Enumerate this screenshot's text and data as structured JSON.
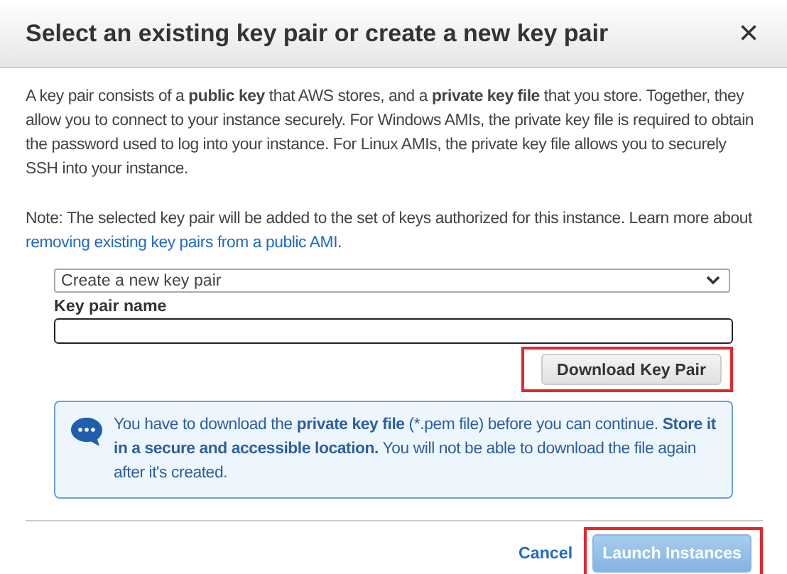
{
  "dialog": {
    "title": "Select an existing key pair or create a new key pair",
    "close": "×"
  },
  "intro": "A key pair consists of a **public key** that AWS stores, and a **private key file** that you store. Together, they allow you to connect to your instance securely. For Windows AMIs, the private key file is required to obtain the password used to log into your instance. For Linux AMIs, the private key file allows you to securely SSH into your instance.",
  "note": {
    "text": "Note: The selected key pair will be added to the set of keys authorized for this instance. Learn more about",
    "link": "removing existing key pairs from a public AMI",
    "after": "."
  },
  "key_pair_select": {
    "value": "Create a new key pair"
  },
  "key_pair_name": {
    "label": "Key pair name"
  },
  "download_button": {
    "label": "Download Key Pair",
    "highlighted": true
  },
  "info": "You have to download the **private key file** (*.pem file) before you can continue. **Store it in a secure and accessible location.** You will not be able to download the file again after it's created.",
  "footer": {
    "cancel": "Cancel",
    "launch": {
      "label": "Launch Instances",
      "disabled": true,
      "highlighted": true
    }
  }
}
